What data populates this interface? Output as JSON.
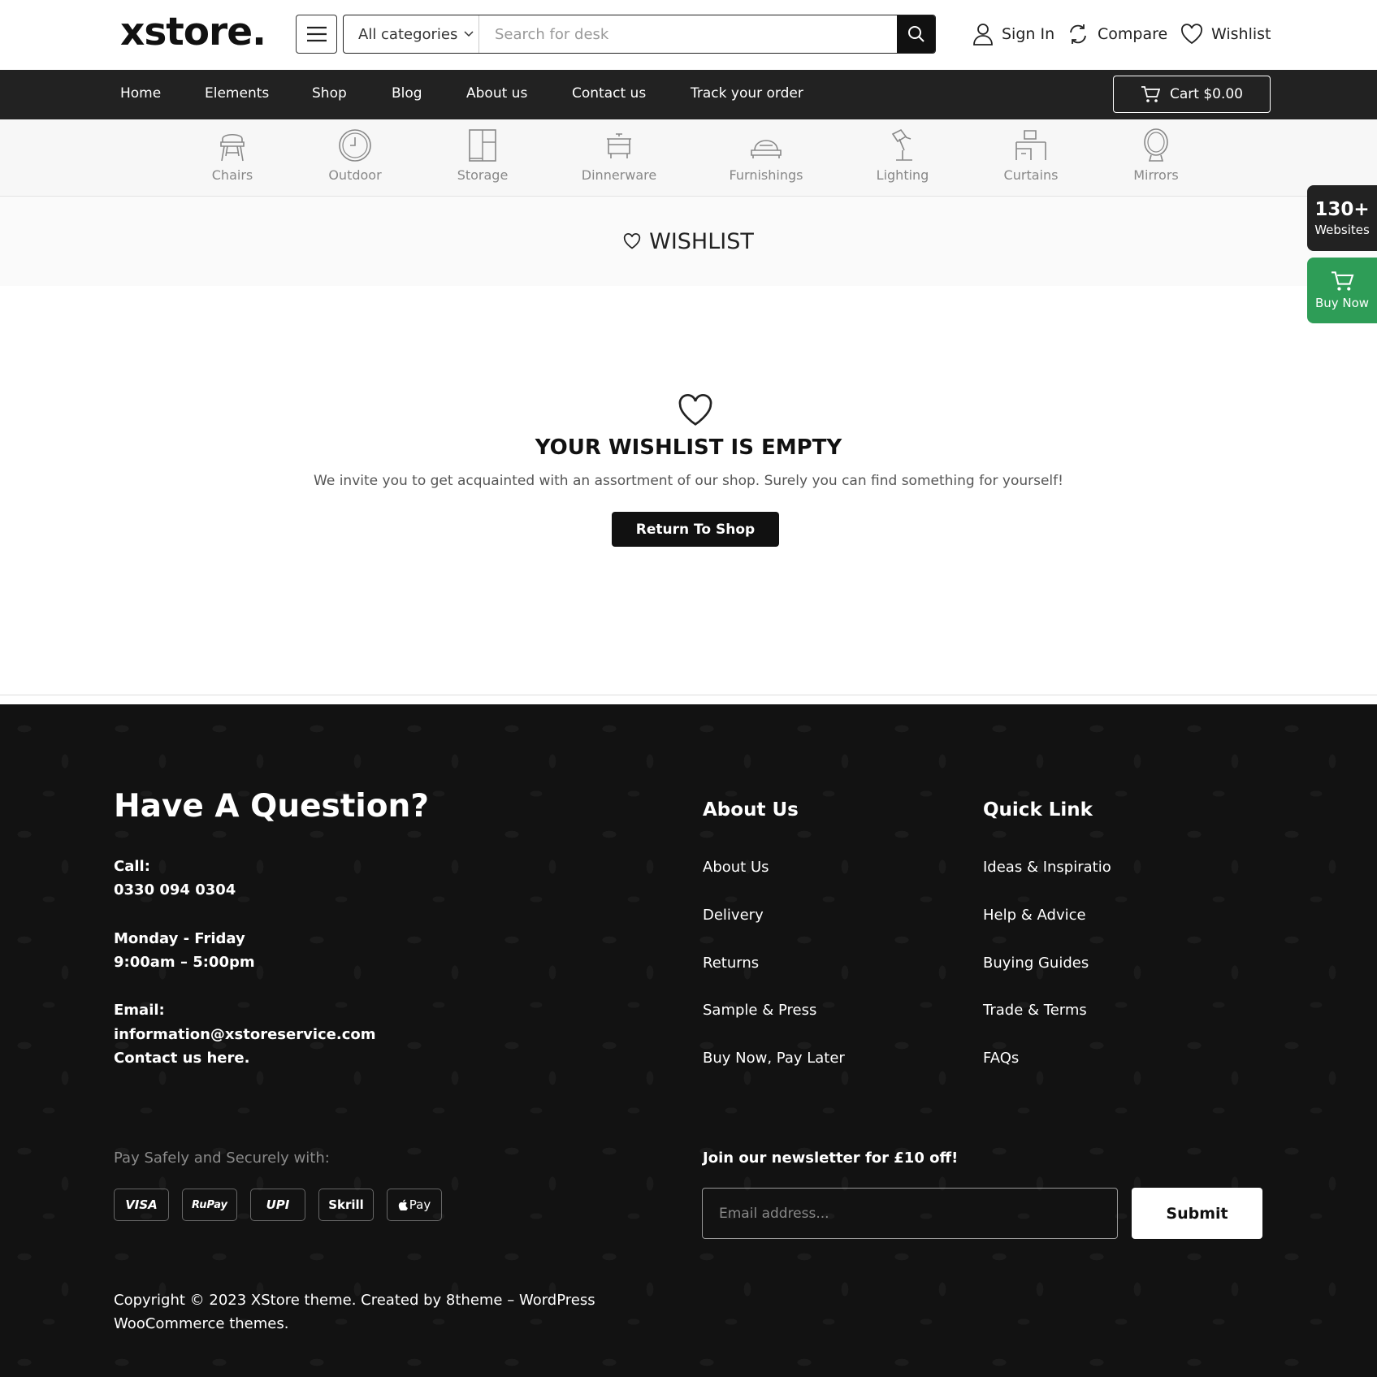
{
  "header": {
    "logo": "xstore.",
    "categories_label": "All categories",
    "search_placeholder": "Search for desk",
    "sign_in": "Sign In",
    "compare": "Compare",
    "wishlist": "Wishlist"
  },
  "nav": {
    "items": [
      "Home",
      "Elements",
      "Shop",
      "Blog",
      "About us",
      "Contact us",
      "Track your order"
    ],
    "cart_label": "Cart $0.00"
  },
  "categories": [
    "Chairs",
    "Outdoor",
    "Storage",
    "Dinnerware",
    "Furnishings",
    "Lighting",
    "Curtains",
    "Mirrors"
  ],
  "page": {
    "title": "WISHLIST",
    "empty_title": "YOUR WISHLIST IS EMPTY",
    "empty_desc": "We invite you to get acquainted with an assortment of our shop. Surely you can find something for yourself!",
    "return_button": "Return To Shop"
  },
  "floating": {
    "websites_count": "130+",
    "websites_label": "Websites",
    "buy_now": "Buy Now"
  },
  "footer": {
    "question_title": "Have A Question?",
    "call_label": "Call:",
    "phone": "0330 094 0304",
    "days": "Monday - Friday",
    "hours": "9:00am – 5:00pm",
    "email_label": "Email:",
    "email": "information@xstoreservice.com",
    "contact_link": "Contact us here.",
    "about_heading": "About Us",
    "about_links": [
      "About Us",
      "Delivery",
      "Returns",
      "Sample & Press",
      "Buy Now, Pay Later"
    ],
    "quick_heading": "Quick Link",
    "quick_links": [
      "Ideas & Inspiratio",
      "Help & Advice",
      "Buying Guides",
      "Trade & Terms",
      "FAQs"
    ],
    "pay_label": "Pay Safely and Securely with:",
    "payment_methods": [
      "VISA",
      "RuPay",
      "UPI",
      "Skrill",
      "Pay"
    ],
    "newsletter_title": "Join our newsletter for £10 off!",
    "email_placeholder": "Email address...",
    "submit_label": "Submit",
    "copyright_line1": "Copyright © 2023 XStore theme. Created by 8theme – WordPress",
    "copyright_line2": "WooCommerce themes."
  },
  "colors": {
    "dark": "#222222",
    "footer_bg": "#121212",
    "buy_green": "#2e9d57"
  }
}
